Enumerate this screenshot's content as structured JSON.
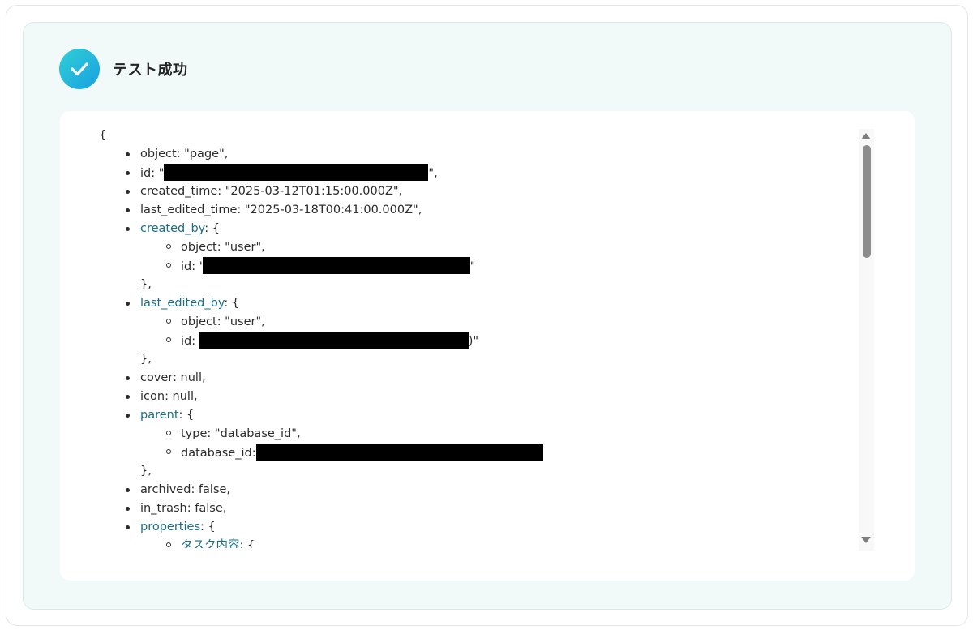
{
  "title": "テスト成功",
  "json_view": {
    "open_brace": "{",
    "lines": [
      {
        "level": 1,
        "key": "object",
        "value": ": \"page\","
      },
      {
        "level": 1,
        "key": "id",
        "value": ": \"",
        "redacted": true,
        "suffix": "\","
      },
      {
        "level": 1,
        "key": "created_time",
        "value": ": \"2025-03-12T01:15:00.000Z\","
      },
      {
        "level": 1,
        "key": "last_edited_time",
        "value": ": \"2025-03-18T00:41:00.000Z\","
      },
      {
        "level": 1,
        "key": "created_by",
        "link": true,
        "value": ": {"
      },
      {
        "level": 2,
        "key": "object",
        "value": ": \"user\","
      },
      {
        "level": 2,
        "key": "id",
        "value": ": '",
        "redacted": true,
        "suffix": "\""
      },
      {
        "level": 0,
        "value": "},"
      },
      {
        "level": 1,
        "key": "last_edited_by",
        "link": true,
        "value": ": {"
      },
      {
        "level": 2,
        "key": "object",
        "value": ": \"user\","
      },
      {
        "level": 2,
        "key": "id",
        "value": ": ",
        "redacted": true,
        "suffix": ")\""
      },
      {
        "level": 0,
        "value": "},"
      },
      {
        "level": 1,
        "key": "cover",
        "value": ": null,"
      },
      {
        "level": 1,
        "key": "icon",
        "value": ": null,"
      },
      {
        "level": 1,
        "key": "parent",
        "link": true,
        "value": ": {"
      },
      {
        "level": 2,
        "key": "type",
        "value": ": \"database_id\","
      },
      {
        "level": 2,
        "key": "database_id",
        "value": ":",
        "redacted": true,
        "suffix": ""
      },
      {
        "level": 0,
        "value": "},"
      },
      {
        "level": 1,
        "key": "archived",
        "value": ": false,"
      },
      {
        "level": 1,
        "key": "in_trash",
        "value": ": false,"
      },
      {
        "level": 1,
        "key": "properties",
        "link": true,
        "value": ": {"
      },
      {
        "level": 2,
        "key": "タスク内容",
        "link": true,
        "value": ": {"
      }
    ]
  },
  "icons": {
    "success": "check-circle-icon",
    "scroll_up": "arrow-up-icon",
    "scroll_down": "arrow-down-icon"
  },
  "colors": {
    "accent": "#1fb8dc",
    "link": "#1a6e86",
    "panel_bg": "#f2f9f9"
  }
}
